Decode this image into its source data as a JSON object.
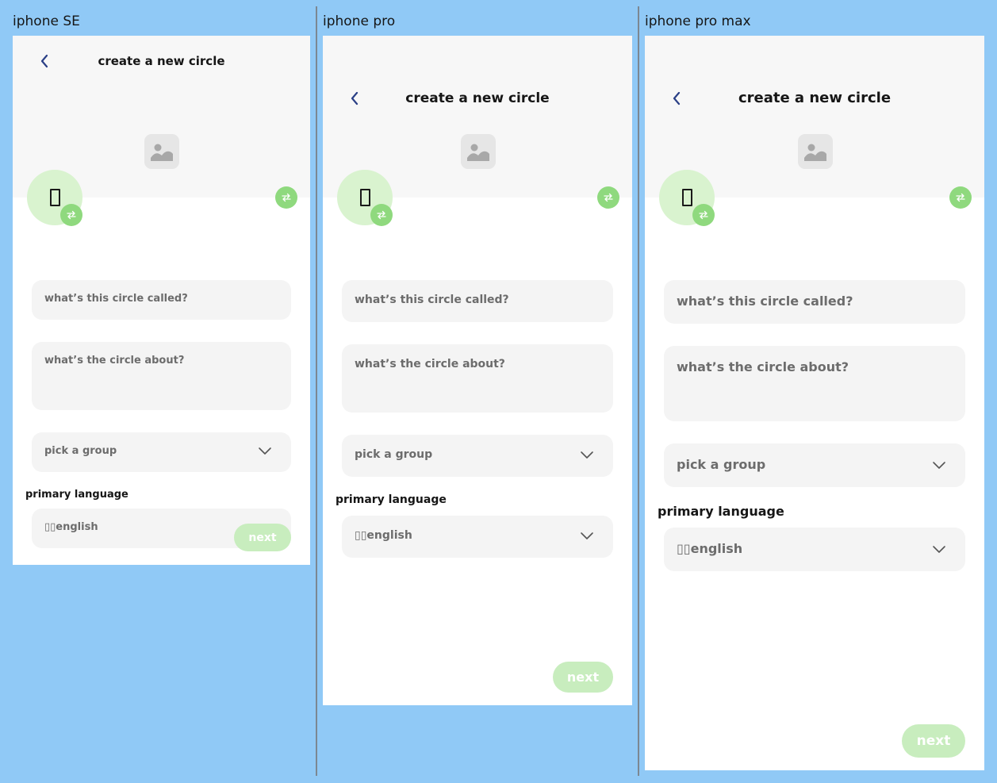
{
  "frames": {
    "se": {
      "label": "iphone SE"
    },
    "pro": {
      "label": "iphone pro"
    },
    "max": {
      "label": "iphone pro max"
    }
  },
  "screen": {
    "title": "create a new circle",
    "name_placeholder": "what’s this circle called?",
    "about_placeholder": "what’s the circle about?",
    "group_placeholder": "pick a group",
    "language_label": "primary language",
    "language_value": "▯▯english",
    "next_label": "next"
  },
  "icons": {
    "back": "chevron-left-icon",
    "cover": "image-placeholder-icon",
    "swap": "swap-arrows-icon",
    "dropdown": "chevron-down-icon"
  },
  "colors": {
    "background": "#90c9f6",
    "accent_green": "#8fd97e",
    "avatar_green": "#d9f3cf",
    "next_disabled": "#c8edbe",
    "field_bg": "#f4f4f4",
    "back_arrow": "#2a3f86"
  }
}
